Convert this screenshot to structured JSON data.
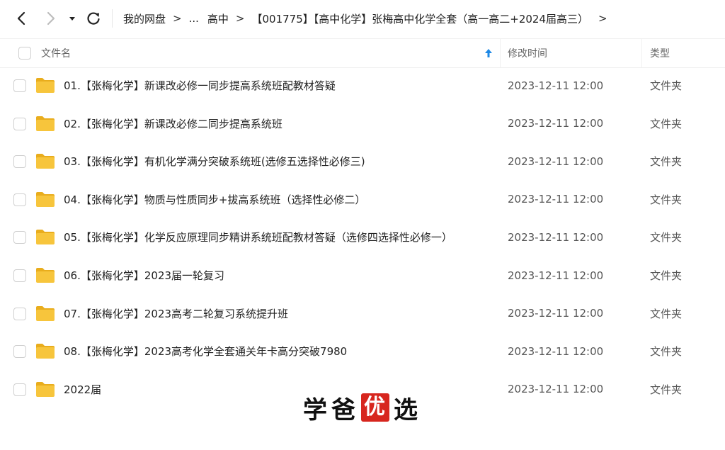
{
  "breadcrumb": {
    "root": "我的网盘",
    "ellipsis": "...",
    "level1": "高中",
    "current": "【001775】【高中化学】张梅高中化学全套（高一高二+2024届高三）",
    "more": ">"
  },
  "columns": {
    "name": "文件名",
    "modified": "修改时间",
    "type": "类型"
  },
  "files": [
    {
      "name": "01.【张梅化学】新课改必修一同步提高系统班配教材答疑",
      "modified": "2023-12-11 12:00",
      "type": "文件夹"
    },
    {
      "name": "02.【张梅化学】新课改必修二同步提高系统班",
      "modified": "2023-12-11 12:00",
      "type": "文件夹"
    },
    {
      "name": "03.【张梅化学】有机化学满分突破系统班(选修五选择性必修三)",
      "modified": "2023-12-11 12:00",
      "type": "文件夹"
    },
    {
      "name": "04.【张梅化学】物质与性质同步+拔高系统班（选择性必修二）",
      "modified": "2023-12-11 12:00",
      "type": "文件夹"
    },
    {
      "name": "05.【张梅化学】化学反应原理同步精讲系统班配教材答疑（选修四选择性必修一）",
      "modified": "2023-12-11 12:00",
      "type": "文件夹"
    },
    {
      "name": "06.【张梅化学】2023届一轮复习",
      "modified": "2023-12-11 12:00",
      "type": "文件夹"
    },
    {
      "name": "07.【张梅化学】2023高考二轮复习系统提升班",
      "modified": "2023-12-11 12:00",
      "type": "文件夹"
    },
    {
      "name": "08.【张梅化学】2023高考化学全套通关年卡高分突破7980",
      "modified": "2023-12-11 12:00",
      "type": "文件夹"
    },
    {
      "name": "2022届",
      "modified": "2023-12-11 12:00",
      "type": "文件夹"
    }
  ],
  "watermark": {
    "c1": "学",
    "c2": "爸",
    "c3": "优",
    "c4": "选"
  },
  "colors": {
    "folder": "#f7c53c",
    "folder_dark": "#e9ad1d",
    "sort_arrow": "#1e88e5",
    "seal": "#d7261e"
  }
}
